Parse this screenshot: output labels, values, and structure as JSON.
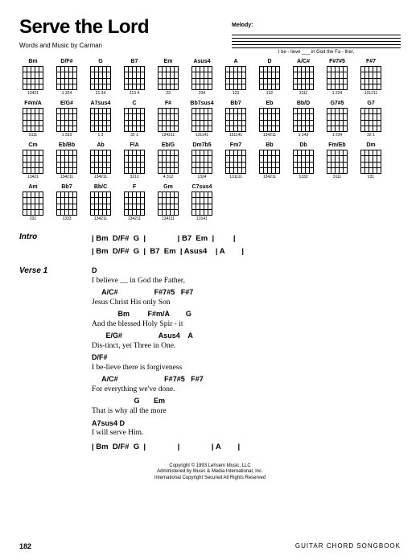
{
  "title": "Serve the Lord",
  "byline": "Words and Music by Carman",
  "melody": {
    "label": "Melody:",
    "lyrics": "I    be - lieve ___  in God  the    Fa  -  ther,"
  },
  "chords": [
    {
      "name": "Bm",
      "finger": "13421"
    },
    {
      "name": "D/F#",
      "finger": "1 324"
    },
    {
      "name": "G",
      "finger": "21   34"
    },
    {
      "name": "B7",
      "finger": "213 4"
    },
    {
      "name": "Em",
      "finger": "23"
    },
    {
      "name": "Asus4",
      "finger": "234"
    },
    {
      "name": "A",
      "finger": "123"
    },
    {
      "name": "D",
      "finger": "132"
    },
    {
      "name": "A/C#",
      "finger": "3111"
    },
    {
      "name": "F#7#5",
      "finger": "1  234"
    },
    {
      "name": "F#7",
      "finger": "131211"
    },
    {
      "name": "F#m/A",
      "finger": "3111"
    },
    {
      "name": "E/G#",
      "finger": "1 333"
    },
    {
      "name": "A7sus4",
      "finger": "1 3"
    },
    {
      "name": "C",
      "finger": "32 1"
    },
    {
      "name": "F#",
      "finger": "134211"
    },
    {
      "name": "Bb7sus4",
      "finger": "131141"
    },
    {
      "name": "Bb7",
      "finger": "131141"
    },
    {
      "name": "Eb",
      "finger": "134211"
    },
    {
      "name": "Bb/D",
      "finger": "1 243"
    },
    {
      "name": "G7#5",
      "finger": "1  234"
    },
    {
      "name": "G7",
      "finger": "32   1"
    },
    {
      "name": "Cm",
      "finger": "13421"
    },
    {
      "name": "Eb/Bb",
      "finger": "134211"
    },
    {
      "name": "Ab",
      "finger": "134211"
    },
    {
      "name": "F/A",
      "finger": "3211"
    },
    {
      "name": "Eb/G",
      "finger": "4 312"
    },
    {
      "name": "Dm7b5",
      "finger": "1324"
    },
    {
      "name": "Fm7",
      "finger": "131111"
    },
    {
      "name": "Bb",
      "finger": "134211"
    },
    {
      "name": "Db",
      "finger": "1333"
    },
    {
      "name": "Fm/Eb",
      "finger": "3111"
    },
    {
      "name": "Dm",
      "finger": "231"
    },
    {
      "name": "Am",
      "finger": "231"
    },
    {
      "name": "Bb7",
      "finger": "1333"
    },
    {
      "name": "Bb/C",
      "finger": "134211"
    },
    {
      "name": "F",
      "finger": "134211"
    },
    {
      "name": "Gm",
      "finger": "134111"
    },
    {
      "name": "C7sus4",
      "finger": "13141"
    }
  ],
  "intro": {
    "label": "Intro",
    "bars1": "| Bm  D/F#  G  |               | B7  Em  |         |",
    "bars2": "| Bm  D/F#  G  |  B7  Em  | Asus4    | A        |"
  },
  "verse1": {
    "label": "Verse 1",
    "lines": [
      {
        "chords": "D",
        "lyric": "I believe __ in God the Father,"
      },
      {
        "chords": "     A/C#                  F#7#5   F#7",
        "lyric": "Jesus Christ His only Son"
      },
      {
        "chords": "             Bm         F#m/A        G",
        "lyric": "And the blessed Holy Spir - it"
      },
      {
        "chords": "       E/G#                  Asus4    A",
        "lyric": "Dis-tinct, yet Three in One."
      },
      {
        "chords": "D/F#",
        "lyric": "I be-lieve there is forgiveness"
      },
      {
        "chords": "     A/C#                       F#7#5   F#7",
        "lyric": "For everything we've done."
      },
      {
        "chords": "                     G       Em",
        "lyric": "That is why all the more"
      },
      {
        "chords": "A7sus4 D",
        "lyric": "I will     serve Him."
      }
    ],
    "outro": "| Bm  D/F#  G  |               |               | A        |"
  },
  "copyright": {
    "l1": "Copyright © 1993 Lehsem Music, LLC",
    "l2": "Administered by Music & Media International, Inc.",
    "l3": "International Copyright Secured  All Rights Reserved"
  },
  "footer": {
    "page": "182",
    "book": "GUITAR CHORD SONGBOOK"
  }
}
